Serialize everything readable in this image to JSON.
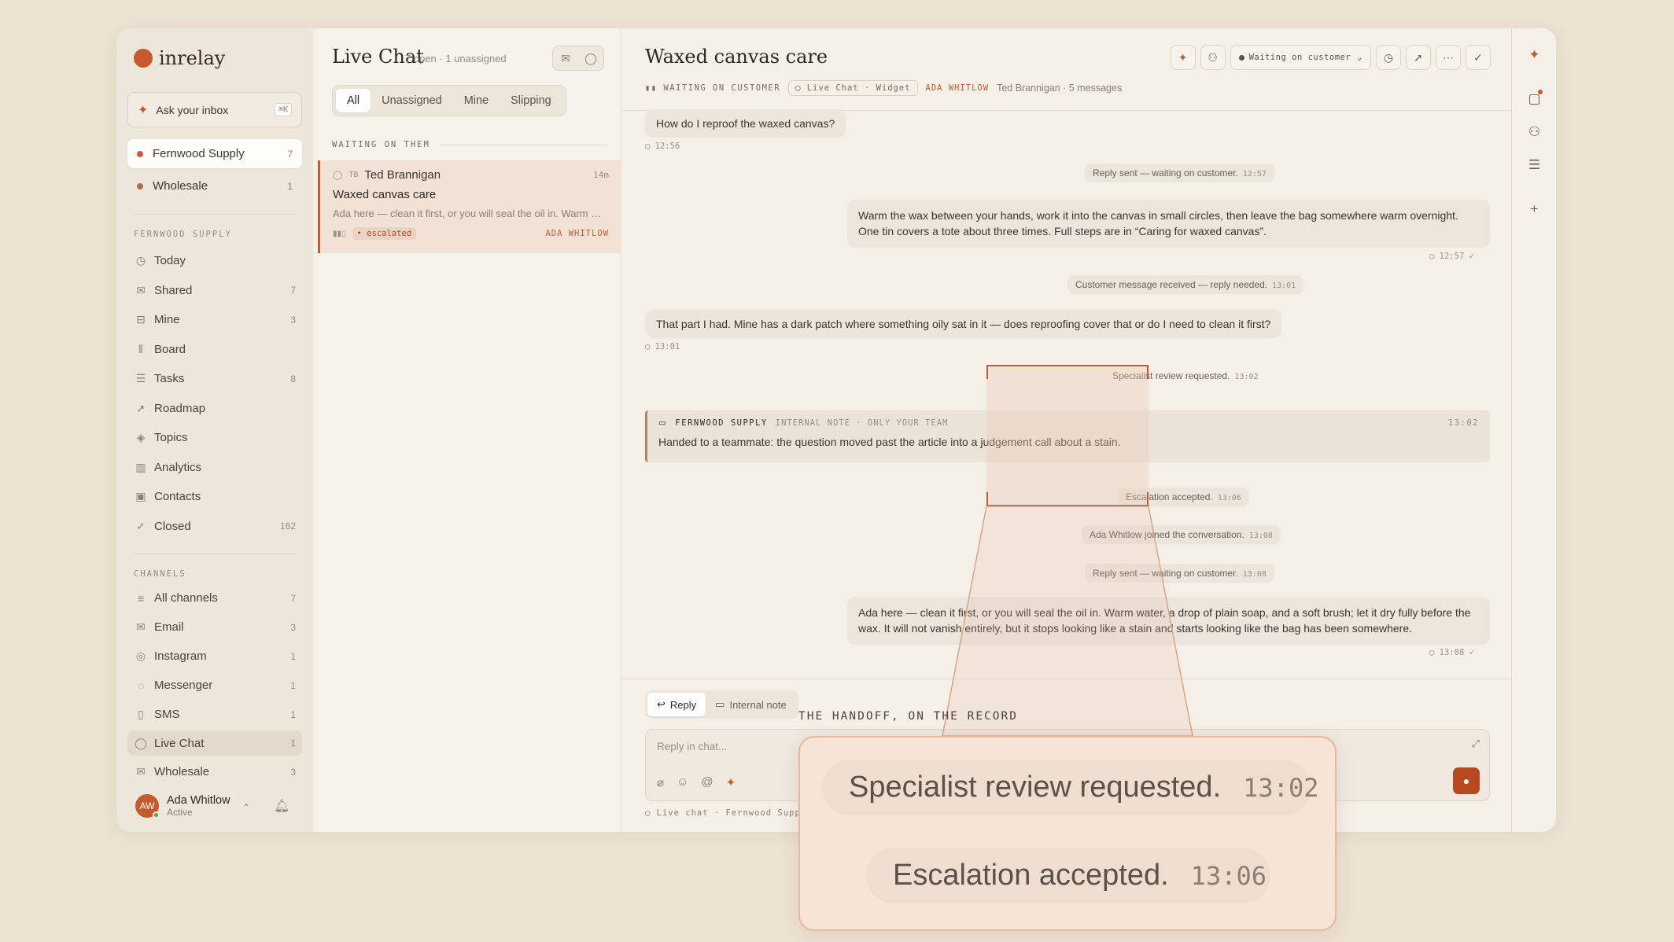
{
  "brand": {
    "name": "inrelay"
  },
  "ask": {
    "label": "Ask your inbox",
    "shortcut": "⌘K"
  },
  "inboxes": [
    {
      "label": "Fernwood Supply",
      "count": "7"
    },
    {
      "label": "Wholesale",
      "count": "1"
    }
  ],
  "section_fernwood": "FERNWOOD SUPPLY",
  "nav": [
    {
      "label": "Today",
      "count": "",
      "icon": "clock-icon"
    },
    {
      "label": "Shared",
      "count": "7",
      "icon": "mail-icon"
    },
    {
      "label": "Mine",
      "count": "3",
      "icon": "inbox-icon"
    },
    {
      "label": "Board",
      "count": "",
      "icon": "board-icon"
    },
    {
      "label": "Tasks",
      "count": "8",
      "icon": "tasks-icon"
    },
    {
      "label": "Roadmap",
      "count": "",
      "icon": "rocket-icon"
    },
    {
      "label": "Topics",
      "count": "",
      "icon": "tag-icon"
    },
    {
      "label": "Analytics",
      "count": "",
      "icon": "chart-icon"
    },
    {
      "label": "Contacts",
      "count": "",
      "icon": "contacts-icon"
    },
    {
      "label": "Closed",
      "count": "162",
      "icon": "check-icon"
    }
  ],
  "section_channels": "CHANNELS",
  "channels": [
    {
      "label": "All channels",
      "count": "7"
    },
    {
      "label": "Email",
      "count": "3"
    },
    {
      "label": "Instagram",
      "count": "1"
    },
    {
      "label": "Messenger",
      "count": "1"
    },
    {
      "label": "SMS",
      "count": "1"
    },
    {
      "label": "Live Chat",
      "count": "1"
    },
    {
      "label": "Wholesale",
      "count": "3"
    }
  ],
  "user": {
    "initials": "AW",
    "name": "Ada Whitlow",
    "status": "Active"
  },
  "list": {
    "title": "Live Chat",
    "meta": "7 open · 1 unassigned",
    "tabs": [
      "All",
      "Unassigned",
      "Mine",
      "Slipping"
    ],
    "group": "WAITING ON THEM",
    "card": {
      "initials": "TB",
      "name": "Ted Brannigan",
      "age": "14m",
      "subject": "Waxed canvas care",
      "preview": "Ada here — clean it first, or you will seal the oil in. Warm water, a drop of plain soap, and a soft brush",
      "tag": "• escalated",
      "assignee": "ADA WHITLOW"
    }
  },
  "conv": {
    "title": "Waxed canvas care",
    "status": "WAITING ON CUSTOMER",
    "channel": "Live Chat · Widget",
    "assignee": "ADA WHITLOW",
    "meta": "Ted Brannigan · 5 messages",
    "status_dropdown": "Waiting on customer",
    "msg1": {
      "text": "How do I reproof the waxed canvas?",
      "time": "12:56"
    },
    "sys1": {
      "text": "Reply sent — waiting on customer.",
      "time": "12:57"
    },
    "msg2": {
      "text": "Warm the wax between your hands, work it into the canvas in small circles, then leave the bag somewhere warm overnight. One tin covers a tote about three times. Full steps are in “Caring for waxed canvas”.",
      "time": "12:57 ✓"
    },
    "sys2": {
      "text": "Customer message received — reply needed.",
      "time": "13:01"
    },
    "msg3": {
      "text": "That part I had. Mine has a dark patch where something oily sat in it — does reproofing cover that or do I need to clean it first?",
      "time": "13:01"
    },
    "sys3": {
      "text": "Specialist review requested.",
      "time": "13:02"
    },
    "note": {
      "org": "FERNWOOD SUPPLY",
      "sub": "INTERNAL NOTE · ONLY YOUR TEAM",
      "time": "13:02",
      "text": "Handed to a teammate: the question moved past the article into a judgement call about a stain."
    },
    "sys4": {
      "text": "Escalation accepted.",
      "time": "13:06"
    },
    "sys5": {
      "text": "Ada Whitlow joined the conversation.",
      "time": "13:08"
    },
    "sys6": {
      "text": "Reply sent — waiting on customer.",
      "time": "13:08"
    },
    "msg4": {
      "text": "Ada here — clean it first, or you will seal the oil in. Warm water, a drop of plain soap, and a soft brush; let it dry fully before the wax. It will not vanish entirely, but it stops looking like a stain and starts looking like the bag has been somewhere.",
      "time": "13:08 ✓"
    }
  },
  "composer": {
    "tab_reply": "Reply",
    "tab_note": "Internal note",
    "placeholder": "Reply in chat...",
    "footer": "Live chat · Fernwood Suppl"
  },
  "overlay": {
    "caption": "THE HANDOFF, ON THE RECORD",
    "line1": {
      "text": "Specialist review requested.",
      "time": "13:02"
    },
    "line2": {
      "text": "Escalation accepted.",
      "time": "13:06"
    }
  },
  "colors": {
    "accent": "#c65a2e",
    "background": "#ede3d3"
  }
}
